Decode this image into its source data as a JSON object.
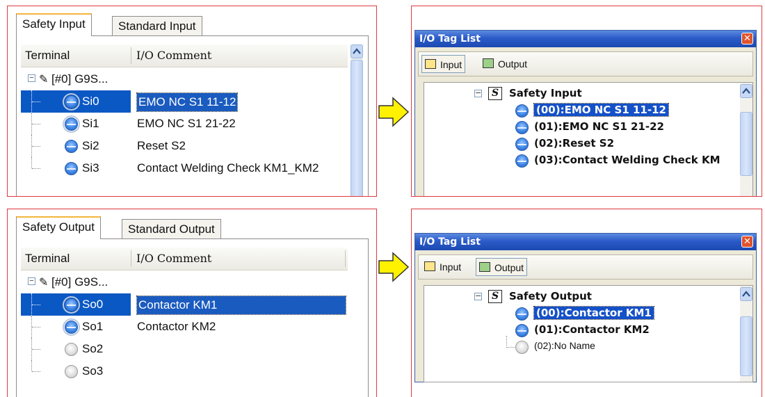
{
  "safety_input_editor": {
    "tabs": [
      "Safety Input",
      "Standard Input"
    ],
    "columns": [
      "Terminal",
      "I/O Comment"
    ],
    "device": "[#0] G9S...",
    "rows": [
      {
        "terminal": "Si0",
        "comment": "EMO NC S1 11-12",
        "selected": true
      },
      {
        "terminal": "Si1",
        "comment": "EMO NC S1 21-22"
      },
      {
        "terminal": "Si2",
        "comment": "Reset S2"
      },
      {
        "terminal": "Si3",
        "comment": "Contact Welding Check KM1_KM2"
      }
    ]
  },
  "safety_output_editor": {
    "tabs": [
      "Safety Output",
      "Standard Output"
    ],
    "columns": [
      "Terminal",
      "I/O Comment"
    ],
    "device": "[#0] G9S...",
    "rows": [
      {
        "terminal": "So0",
        "comment": "Contactor KM1",
        "selected": true
      },
      {
        "terminal": "So1",
        "comment": "Contactor KM2"
      },
      {
        "terminal": "So2",
        "comment": ""
      },
      {
        "terminal": "So3",
        "comment": ""
      }
    ]
  },
  "tag_list_input": {
    "title": "I/O Tag List",
    "close": "✕",
    "buttons": [
      "Input",
      "Output"
    ],
    "active_button": "Input",
    "group_icon": "S",
    "group": "Safety Input",
    "tags": [
      "(00):EMO NC S1 11-12",
      "(01):EMO NC S1 21-22",
      "(02):Reset S2",
      "(03):Contact Welding Check KM"
    ]
  },
  "tag_list_output": {
    "title": "I/O Tag List",
    "close": "✕",
    "buttons": [
      "Input",
      "Output"
    ],
    "active_button": "Output",
    "group_icon": "S",
    "group": "Safety Output",
    "tags": [
      "(00):Contactor KM1",
      "(01):Contactor KM2",
      "(02):No Name"
    ]
  },
  "colors": {
    "frame_border": "#e0393e",
    "selection": "#0a58c4",
    "arrow_fill": "#fff200",
    "titlebar": "#2b5bc8"
  }
}
